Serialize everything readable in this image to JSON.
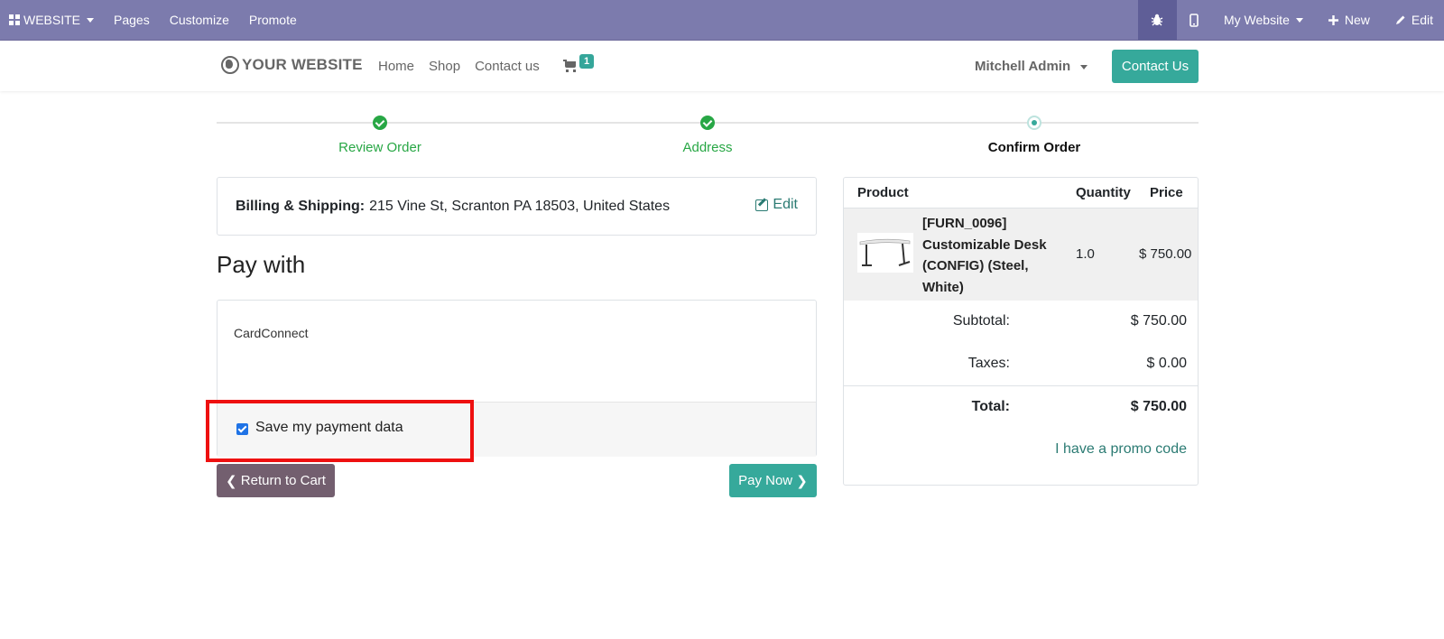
{
  "topbar": {
    "website_label": "WEBSITE",
    "menu": [
      "Pages",
      "Customize",
      "Promote"
    ],
    "my_website_label": "My Website",
    "new_label": "New",
    "edit_label": "Edit"
  },
  "header": {
    "logo_text": "YOUR WEBSITE",
    "nav": [
      "Home",
      "Shop",
      "Contact us"
    ],
    "cart_count": "1",
    "user_name": "Mitchell Admin",
    "contact_button": "Contact Us"
  },
  "progress": {
    "steps": [
      "Review Order",
      "Address",
      "Confirm Order"
    ]
  },
  "billing": {
    "label": "Billing & Shipping:",
    "address": "215 Vine St, Scranton PA 18503, United States",
    "edit_label": "Edit"
  },
  "payment": {
    "heading": "Pay with",
    "acquirer": "CardConnect",
    "save_label": "Save my payment data",
    "save_checked": true
  },
  "buttons": {
    "return_label": "Return to Cart",
    "pay_label": "Pay Now"
  },
  "summary": {
    "headers": {
      "product": "Product",
      "quantity": "Quantity",
      "price": "Price"
    },
    "product_name": "[FURN_0096] Customizable Desk (CONFIG) (Steel, White)",
    "quantity": "1.0",
    "price": "$ 750.00",
    "subtotal_label": "Subtotal:",
    "subtotal": "$ 750.00",
    "taxes_label": "Taxes:",
    "taxes": "$ 0.00",
    "total_label": "Total:",
    "total": "$ 750.00",
    "promo_label": "I have a promo code"
  }
}
